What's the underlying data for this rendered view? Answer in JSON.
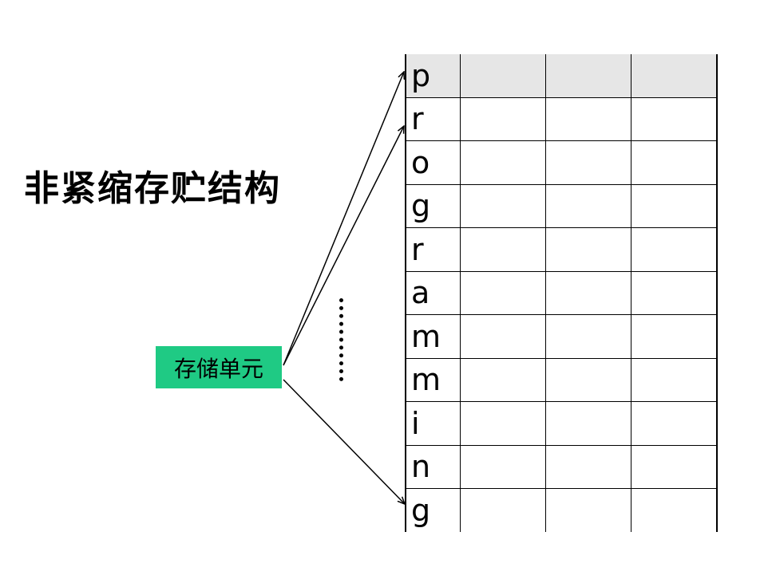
{
  "title": "非紧缩存贮结构",
  "label": "存储单元",
  "letters": [
    "p",
    "r",
    "o",
    "g",
    "r",
    "a",
    "m",
    "m",
    "i",
    "n",
    "g"
  ],
  "colors": {
    "label_bg": "#1fca84",
    "first_row_bg": "#e6e6e6",
    "line": "#000000"
  }
}
